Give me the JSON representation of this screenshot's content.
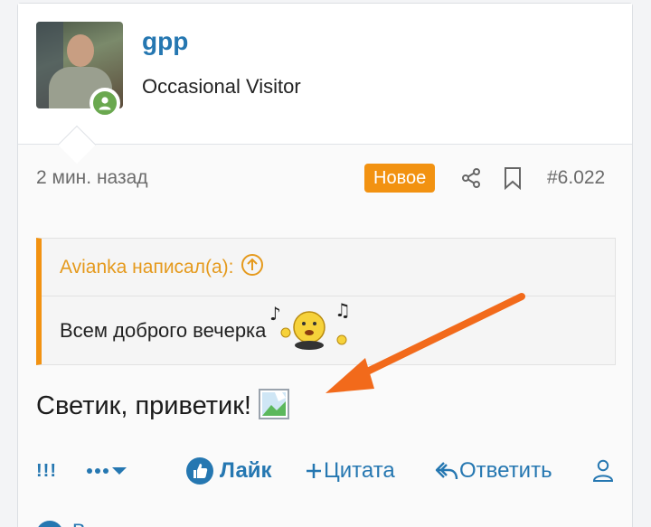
{
  "user": {
    "name": "gpp",
    "title": "Occasional Visitor"
  },
  "meta": {
    "time": "2 мин. назад",
    "badge": "Новое",
    "post_number": "#6.022"
  },
  "quote": {
    "author_line": "Avianka написал(а):",
    "text": "Всем доброго вечерка"
  },
  "post": {
    "text": "Светик, приветик!"
  },
  "actions": {
    "report": "!!!",
    "like": "Лайк",
    "quote": "Цитата",
    "reply": "Ответить"
  },
  "footer": {
    "peek_text": "В"
  },
  "colors": {
    "link": "#2577b1",
    "accent": "#f29211",
    "online": "#6aa84f",
    "annotation_arrow": "#f26a1b"
  },
  "icons": {
    "share": "share-icon",
    "bookmark": "bookmark-icon",
    "like": "thumbs-up-icon",
    "quote": "plus-icon",
    "reply": "reply-icon",
    "profile": "user-icon",
    "more": "ellipsis-icon"
  }
}
